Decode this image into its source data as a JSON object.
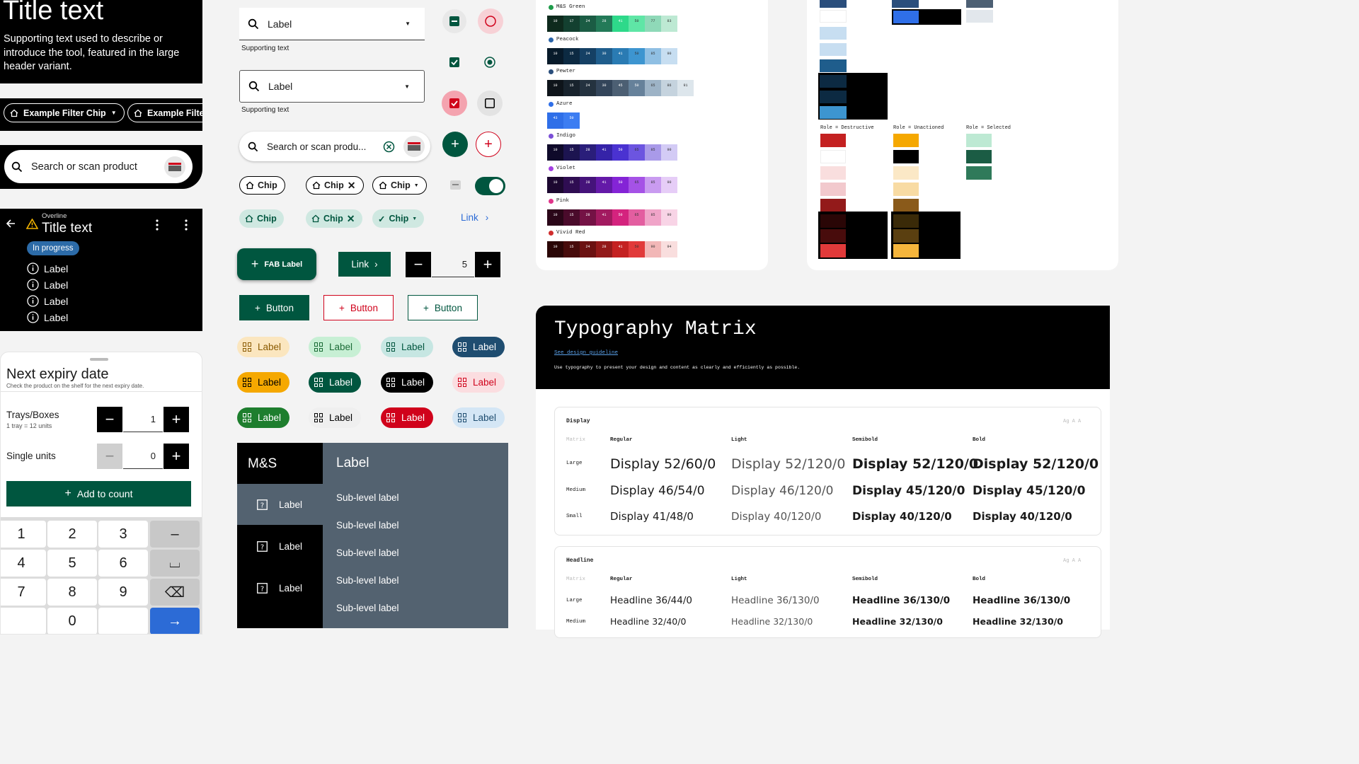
{
  "header_large": {
    "title": "Title text",
    "supporting": "Supporting text used to describe or introduce the tool, featured in the large header variant."
  },
  "filter_chips": [
    "Example Filter Chip",
    "Example Filte"
  ],
  "dark_search": {
    "placeholder": "Search or scan product"
  },
  "app_header": {
    "overline": "Overline",
    "title": "Title text",
    "badge": "In progress",
    "items": [
      "Label",
      "Label",
      "Label",
      "Label"
    ]
  },
  "expiry_sheet": {
    "title": "Next expiry date",
    "subtitle": "Check the product on the shelf for the next expiry date.",
    "trays_label": "Trays/Boxes",
    "trays_sub": "1 tray = 12 units",
    "trays_value": "1",
    "units_label": "Single units",
    "units_value": "0",
    "add_button": "Add to count",
    "keys": [
      "1",
      "2",
      "3",
      "–",
      "4",
      "5",
      "6",
      "⌴",
      "7",
      "8",
      "9",
      "⌫",
      "",
      "0",
      "",
      "→"
    ]
  },
  "dropdown1": {
    "label": "Label",
    "supporting": "Supporting text"
  },
  "dropdown2": {
    "label": "Label",
    "supporting": "Supporting text"
  },
  "search_light": {
    "placeholder": "Search or scan produ..."
  },
  "chips": {
    "chip": "Chip",
    "link": "Link"
  },
  "fab": {
    "label": "FAB Label"
  },
  "link_button": {
    "label": "Link"
  },
  "stepper_mid": {
    "value": "5"
  },
  "buttons": [
    "Button",
    "Button",
    "Button"
  ],
  "labels": [
    "Label",
    "Label",
    "Label",
    "Label",
    "Label",
    "Label",
    "Label",
    "Label",
    "Label",
    "Label",
    "Label",
    "Label"
  ],
  "nav": {
    "brand": "M&S",
    "header": "Label",
    "items": [
      "Label",
      "Label",
      "Label"
    ],
    "sublinks": [
      "Sub-level label",
      "Sub-level label",
      "Sub-level label",
      "Sub-level label",
      "Sub-level label"
    ]
  },
  "palette": {
    "names": [
      "M&S Green",
      "Peacock",
      "Pewter",
      "Azure",
      "Indigo",
      "Violet",
      "Pink",
      "Vivid Red"
    ],
    "colors": [
      "#1e9b4a",
      "#2a64a9",
      "#2a4e7c",
      "#2f6fe8",
      "#7b4fd6",
      "#a33fe0",
      "#e0358a",
      "#d02e2e"
    ],
    "rows": [
      [
        "#0e2a1d",
        "#134030",
        "#1b5c44",
        "#237a58",
        "#2ed98a",
        "#5fe6a6",
        "#8fd9b8",
        "#bde9d3"
      ],
      [
        "#071a2a",
        "#0c2a42",
        "#154064",
        "#1f5d8c",
        "#2a7bb3",
        "#3d95d0",
        "#8fbfe3",
        "#c7def1"
      ],
      [
        "#0e141a",
        "#18232d",
        "#24323f",
        "#33455a",
        "#4c5f73",
        "#66819a",
        "#9db3c6",
        "#c5d3de",
        "#dde6ec"
      ],
      [
        "#2f6fe8",
        "#3c7df2"
      ],
      [
        "#0f0a2a",
        "#1c1450",
        "#2a1e7a",
        "#3523a8",
        "#4a32d1",
        "#6c55e0",
        "#a99ae9",
        "#d3cbf5"
      ],
      [
        "#1c0830",
        "#2f0d52",
        "#45137a",
        "#6419a8",
        "#8424d6",
        "#a552e6",
        "#c99bf0",
        "#e6cdf7"
      ],
      [
        "#2a0618",
        "#4a0b2b",
        "#741245",
        "#a21a60",
        "#d4237e",
        "#e35ea0",
        "#f0a4c8",
        "#f8d4e6"
      ],
      [
        "#2a0606",
        "#480c0c",
        "#6b1212",
        "#931a1a",
        "#c42121",
        "#e13a3a",
        "#f2b7b7",
        "#f9dede"
      ]
    ],
    "labels": [
      [
        "10",
        "17",
        "24",
        "28",
        "41",
        "50",
        "77",
        "83"
      ],
      [
        "10",
        "15",
        "24",
        "30",
        "41",
        "50",
        "85",
        "90"
      ],
      [
        "10",
        "15",
        "24",
        "30",
        "45",
        "50",
        "65",
        "86",
        "91"
      ],
      [
        "43",
        "50"
      ],
      [
        "10",
        "15",
        "28",
        "41",
        "50",
        "65",
        "85",
        "90"
      ],
      [
        "10",
        "15",
        "28",
        "41",
        "50",
        "65",
        "85",
        "90"
      ],
      [
        "10",
        "15",
        "28",
        "41",
        "50",
        "65",
        "85",
        "90"
      ],
      [
        "10",
        "15",
        "24",
        "28",
        "41",
        "50",
        "90",
        "94"
      ]
    ]
  },
  "roles": {
    "destructive": "Role = Destructive",
    "unactioned": "Role = Unactioned",
    "selected": "Role = Selected"
  },
  "typography": {
    "title": "Typography Matrix",
    "link": "See design guideline",
    "desc": "Use typography to present your design and content as clearly and efficiently as possible.",
    "sections": [
      {
        "name": "Display",
        "cols": [
          "Matrix",
          "Regular",
          "Light",
          "Semibold",
          "Bold"
        ],
        "rows": [
          [
            "Large",
            "Display 52/60/0",
            "Display 52/120/0",
            "Display 52/120/0",
            "Display 52/120/0"
          ],
          [
            "Medium",
            "Display 46/54/0",
            "Display 46/120/0",
            "Display 45/120/0",
            "Display 45/120/0"
          ],
          [
            "Small",
            "Display 41/48/0",
            "Display 40/120/0",
            "Display 40/120/0",
            "Display 40/120/0"
          ]
        ]
      },
      {
        "name": "Headline",
        "cols": [
          "Matrix",
          "Regular",
          "Light",
          "Semibold",
          "Bold"
        ],
        "rows": [
          [
            "Large",
            "Headline 36/44/0",
            "Headline 36/130/0",
            "Headline 36/130/0",
            "Headline 36/130/0"
          ],
          [
            "Medium",
            "Headline 32/40/0",
            "Headline 32/130/0",
            "Headline 32/130/0",
            "Headline 32/130/0"
          ]
        ]
      }
    ],
    "ag": "Ag A A"
  },
  "colors": {
    "brand_green": "#00563f",
    "accent_red": "#d0021b",
    "nav_slate": "#536270"
  }
}
